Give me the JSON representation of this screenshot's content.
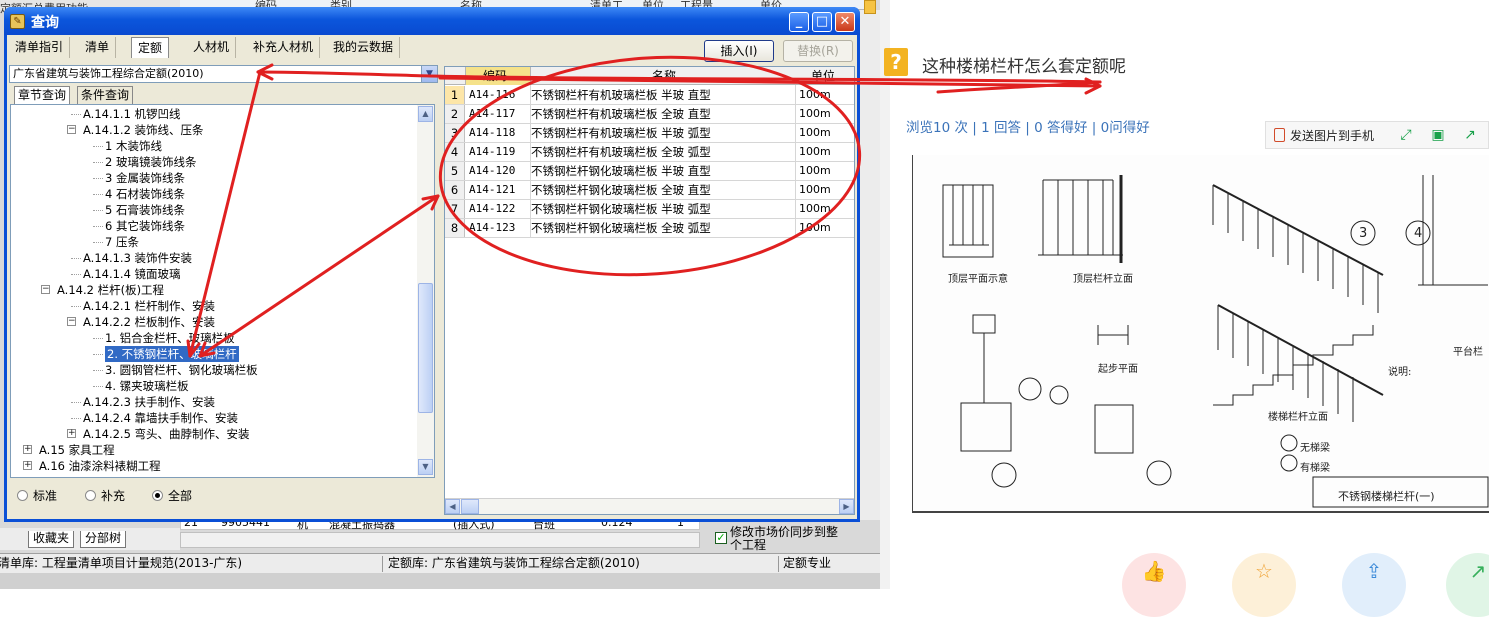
{
  "background_app": {
    "top_header": [
      "编码",
      "类别",
      "名称",
      "清单工",
      "单位",
      "工程量",
      "单价"
    ],
    "left_top_text": "定额汇总费用功能",
    "row21": {
      "num": "21",
      "code": "9905441",
      "type": "机",
      "name": "混凝土振捣器",
      "spec": "(插入式)",
      "unit": "台班",
      "value": "0.124",
      "qty": "1"
    },
    "bottom_tabs": [
      "收藏夹",
      "分部树"
    ],
    "sync_checkbox": {
      "checked": true,
      "label": "修改市场价同步到整个工程"
    },
    "status": {
      "list_lib": "清单库: 工程量清单项目计量规范(2013-广东)",
      "quota_lib": "定额库: 广东省建筑与装饰工程综合定额(2010)",
      "major": "定额专业"
    }
  },
  "dialog": {
    "title": "查询",
    "window_buttons": {
      "minimize": "_",
      "maximize": "□",
      "close": "✕"
    },
    "tabs": [
      "清单指引",
      "清单",
      "定额",
      "人材机",
      "补充人材机",
      "我的云数据"
    ],
    "active_tab": "定额",
    "insert_button": "插入(I)",
    "replace_button": "替换(R)",
    "library_select": "广东省建筑与装饰工程综合定额(2010)",
    "subtabs": [
      "章节查询",
      "条件查询"
    ],
    "tree": [
      {
        "label": "A.14.1.1 机锣凹线",
        "level": 3
      },
      {
        "label": "A.14.1.2 装饰线、压条",
        "level": 3,
        "toggle": "-"
      },
      {
        "label": "1 木装饰线",
        "level": 4
      },
      {
        "label": "2 玻璃镜装饰线条",
        "level": 4
      },
      {
        "label": "3 金属装饰线条",
        "level": 4
      },
      {
        "label": "4 石材装饰线条",
        "level": 4
      },
      {
        "label": "5 石膏装饰线条",
        "level": 4
      },
      {
        "label": "6 其它装饰线条",
        "level": 4
      },
      {
        "label": "7 压条",
        "level": 4
      },
      {
        "label": "A.14.1.3 装饰件安装",
        "level": 3
      },
      {
        "label": "A.14.1.4 镜面玻璃",
        "level": 3
      },
      {
        "label": "A.14.2 栏杆(板)工程",
        "level": 2,
        "toggle": "-"
      },
      {
        "label": "A.14.2.1 栏杆制作、安装",
        "level": 3
      },
      {
        "label": "A.14.2.2 栏板制作、安装",
        "level": 3,
        "toggle": "-"
      },
      {
        "label": "1. 铝合金栏杆、玻璃栏板",
        "level": 4
      },
      {
        "label": "2. 不锈钢栏杆、玻璃栏杆",
        "level": 4,
        "selected": true
      },
      {
        "label": "3. 圆钢管栏杆、钢化玻璃栏板",
        "level": 4
      },
      {
        "label": "4. 镙夹玻璃栏板",
        "level": 4
      },
      {
        "label": "A.14.2.3 扶手制作、安装",
        "level": 3
      },
      {
        "label": "A.14.2.4 靠墙扶手制作、安装",
        "level": 3
      },
      {
        "label": "A.14.2.5 弯头、曲脖制作、安装",
        "level": 3,
        "toggle": "+"
      },
      {
        "label": "A.15 家具工程",
        "level": 1,
        "toggle": "+"
      },
      {
        "label": "A.16 油漆涂料裱糊工程",
        "level": 1,
        "toggle": "+"
      }
    ],
    "radios": [
      {
        "label": "标准",
        "checked": false
      },
      {
        "label": "补充",
        "checked": false
      },
      {
        "label": "全部",
        "checked": true
      }
    ],
    "grid": {
      "headers": {
        "code": "编码",
        "name": "名称",
        "unit": "单位"
      },
      "rows": [
        {
          "num": "1",
          "code": "A14-116",
          "name": "不锈钢栏杆有机玻璃栏板 半玻 直型",
          "unit": "100m"
        },
        {
          "num": "2",
          "code": "A14-117",
          "name": "不锈钢栏杆有机玻璃栏板 全玻 直型",
          "unit": "100m"
        },
        {
          "num": "3",
          "code": "A14-118",
          "name": "不锈钢栏杆有机玻璃栏板 半玻 弧型",
          "unit": "100m"
        },
        {
          "num": "4",
          "code": "A14-119",
          "name": "不锈钢栏杆有机玻璃栏板 全玻 弧型",
          "unit": "100m"
        },
        {
          "num": "5",
          "code": "A14-120",
          "name": "不锈钢栏杆钢化玻璃栏板 半玻 直型",
          "unit": "100m"
        },
        {
          "num": "6",
          "code": "A14-121",
          "name": "不锈钢栏杆钢化玻璃栏板 全玻 直型",
          "unit": "100m"
        },
        {
          "num": "7",
          "code": "A14-122",
          "name": "不锈钢栏杆钢化玻璃栏板 半玻 弧型",
          "unit": "100m"
        },
        {
          "num": "8",
          "code": "A14-123",
          "name": "不锈钢栏杆钢化玻璃栏板 全玻 弧型",
          "unit": "100m"
        }
      ]
    }
  },
  "qa_page": {
    "question_icon": "?",
    "question": "这种楼梯栏杆怎么套定额呢",
    "stats": "浏览10 次 | 1 回答 | 0 答得好 | 0问得好",
    "send_to_phone": "发送图片到手机",
    "toolbar_icons": [
      "fullscreen-icon",
      "save-icon",
      "share-icon"
    ],
    "drawing_labels": {
      "top_plan": "顶层平面示意",
      "top_elev": "顶层栏杆立面",
      "stair_elev": "楼梯栏杆立面",
      "step_plan": "起步平面",
      "notes_title": "说明:",
      "legend_w": "无梯梁",
      "legend_y": "有梯梁",
      "title_block": "不锈钢楼梯栏杆(一)",
      "platform": "平台栏",
      "num3": "3",
      "num4": "4"
    },
    "action_icons": [
      "thumb-up-icon",
      "star-icon",
      "share-icon",
      "next-icon"
    ]
  },
  "colors": {
    "annotation_red": "#e02020",
    "titlebar_blue": "#0a4fd6",
    "selection_blue": "#316ac5",
    "link_blue": "#3b73b9"
  }
}
